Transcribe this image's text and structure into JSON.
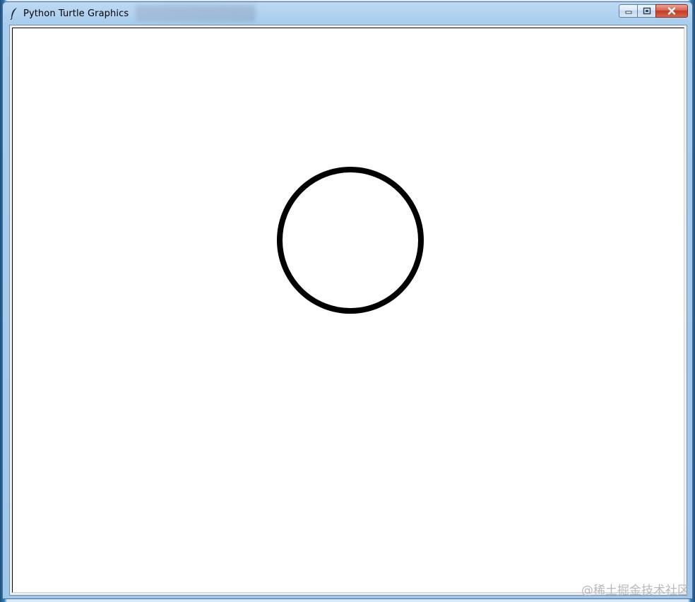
{
  "window": {
    "title": "Python Turtle Graphics",
    "title_icon": "feather-icon",
    "controls": {
      "minimize_icon": "minimize-icon",
      "maximize_icon": "maximize-icon",
      "close_icon": "close-icon"
    }
  },
  "canvas": {
    "background": "#ffffff",
    "drawing": {
      "shape": "circle",
      "stroke_color": "#000000",
      "fill": "none"
    }
  },
  "watermark": "@稀土掘金技术社区",
  "colors": {
    "titlebar": "#a9cdee",
    "close_button": "#c23b25"
  }
}
